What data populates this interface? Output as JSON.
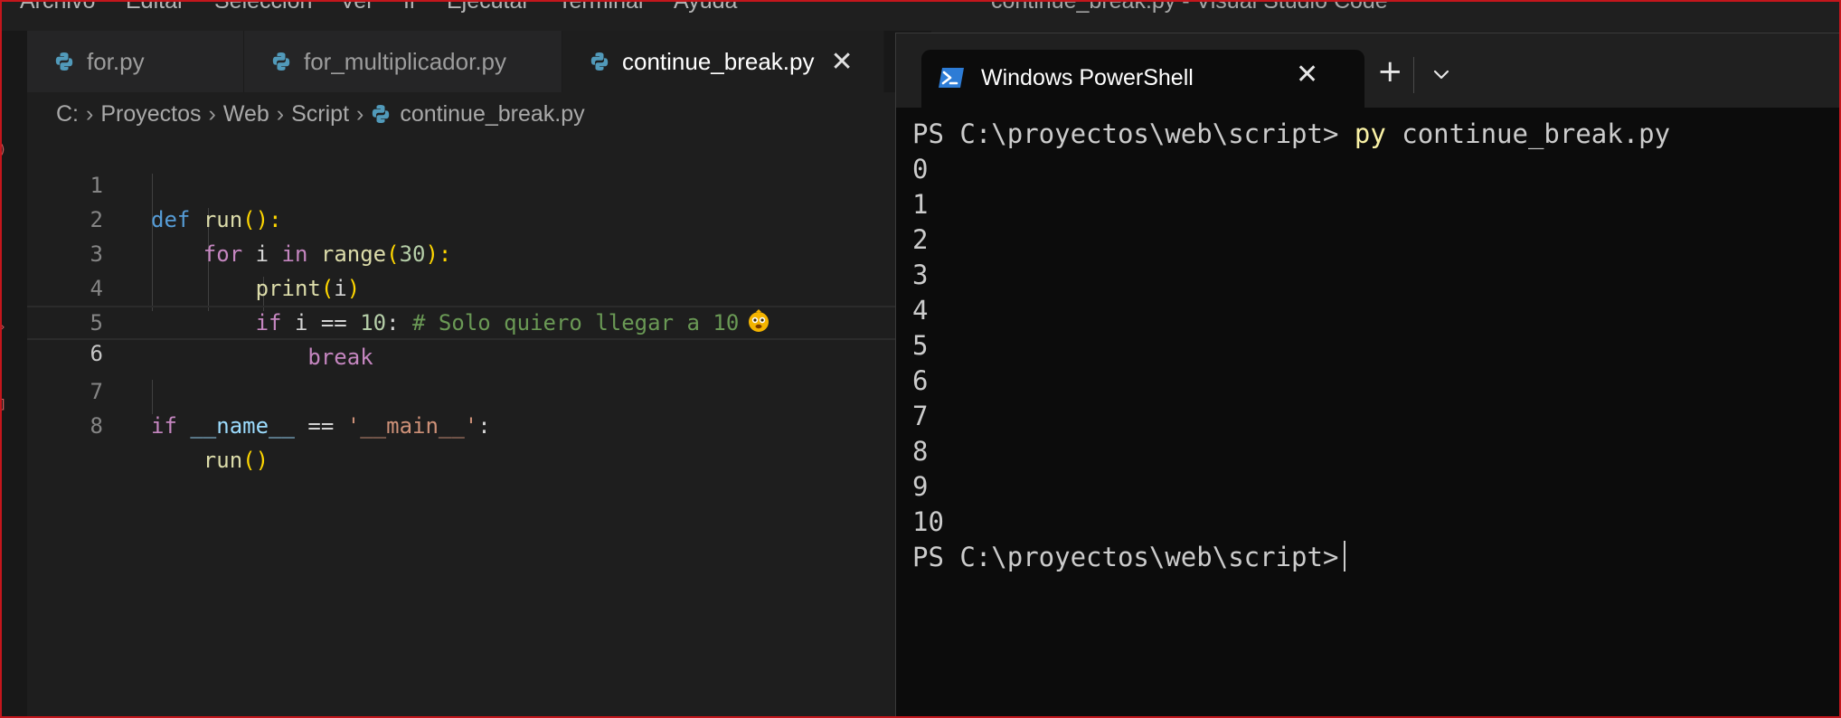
{
  "menubar": {
    "items": [
      "Archivo",
      "Editar",
      "Selección",
      "Ver",
      "Ir",
      "Ejecutar",
      "Terminal",
      "Ayuda"
    ],
    "window_title": "continue_break.py - Visual Studio Code"
  },
  "tabs": [
    {
      "label": "for.py",
      "icon": "python-icon"
    },
    {
      "label": "for_multiplicador.py",
      "icon": "python-icon"
    },
    {
      "label": "continue_break.py",
      "icon": "python-icon",
      "active": true
    }
  ],
  "breadcrumb": [
    "C:",
    "Proyectos",
    "Web",
    "Script",
    "continue_break.py"
  ],
  "editor": {
    "current_line": 6,
    "lines": [
      {
        "num": "1"
      },
      {
        "num": "2"
      },
      {
        "num": "3"
      },
      {
        "num": "4"
      },
      {
        "num": "5"
      },
      {
        "num": "6"
      },
      {
        "num": "7"
      },
      {
        "num": "8"
      }
    ],
    "tokens": {
      "def": "def",
      "run": "run",
      "open_close": "():",
      "for": "for",
      "i": "i",
      "in": "in",
      "range": "range",
      "range_arg": "30",
      "close_colon": "):",
      "print": "print",
      "print_arg": "i",
      "if": "if",
      "eq": "==",
      "ten": "10",
      "colon": ":",
      "comment": "# Solo quiero llegar a 10",
      "break": "break",
      "name": "__name__",
      "main_str": "'__main__'",
      "run_call": "run",
      "call_parens": "()"
    }
  },
  "terminal": {
    "tab_label": "Windows PowerShell",
    "prompt": "PS C:\\proyectos\\web\\script>",
    "command_exe": "py",
    "command_args": "continue_break.py",
    "output": [
      "0",
      "1",
      "2",
      "3",
      "4",
      "5",
      "6",
      "7",
      "8",
      "9",
      "10"
    ]
  },
  "colors": {
    "accent_frame": "#c4161c",
    "editor_bg": "#1e1e1e",
    "terminal_bg": "#0c0c0c",
    "python_icon": "#519aba"
  }
}
